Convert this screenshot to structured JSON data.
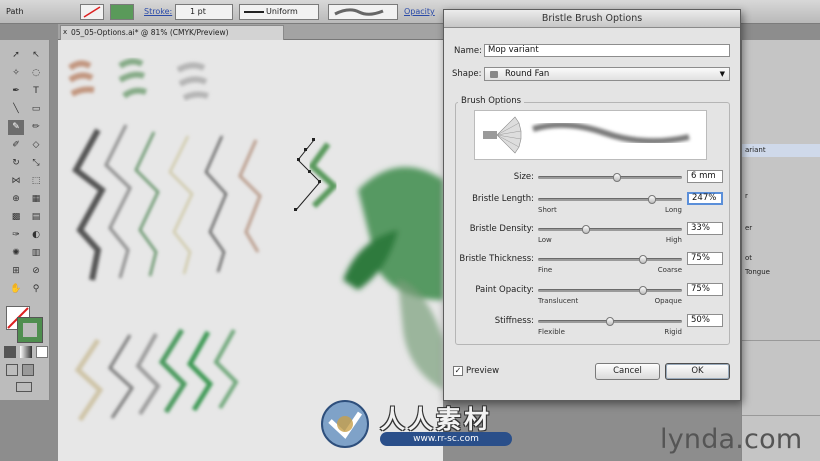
{
  "control_bar": {
    "selection_type": "Path",
    "stroke_label": "Stroke:",
    "stroke_weight": "1 pt",
    "profile": "Uniform",
    "opacity_label": "Opacity"
  },
  "document_tab": {
    "title": "05_05-Options.ai* @ 81% (CMYK/Preview)",
    "close": "x"
  },
  "right_panel": {
    "rows": [
      "ariant",
      "",
      "r",
      "",
      "er",
      "",
      "ot",
      "Tongue"
    ]
  },
  "dialog": {
    "title": "Bristle Brush Options",
    "name_label": "Name:",
    "name_value": "Mop variant",
    "shape_label": "Shape:",
    "shape_value": "Round Fan",
    "brush_options_label": "Brush Options",
    "sliders": [
      {
        "label": "Size:",
        "low": "",
        "high": "",
        "value": "6 mm",
        "position": 0.55
      },
      {
        "label": "Bristle Length:",
        "low": "Short",
        "high": "Long",
        "value": "247%",
        "position": 0.79
      },
      {
        "label": "Bristle Density:",
        "low": "Low",
        "high": "High",
        "value": "33%",
        "position": 0.33
      },
      {
        "label": "Bristle Thickness:",
        "low": "Fine",
        "high": "Coarse",
        "value": "75%",
        "position": 0.73
      },
      {
        "label": "Paint Opacity:",
        "low": "Translucent",
        "high": "Opaque",
        "value": "75%",
        "position": 0.73
      },
      {
        "label": "Stiffness:",
        "low": "Flexible",
        "high": "Rigid",
        "value": "50%",
        "position": 0.5
      }
    ],
    "preview_label": "Preview",
    "preview_checked": true,
    "cancel_label": "Cancel",
    "ok_label": "OK"
  },
  "watermark": {
    "text": "人人素材",
    "url": "www.rr-sc.com"
  },
  "brand": "lynda.com",
  "colors": {
    "dialog_bg": "#e4e4e4",
    "focus_ring": "#5b8fd9",
    "artboard": "#e7e7e7",
    "panel": "#c5c5c5"
  }
}
